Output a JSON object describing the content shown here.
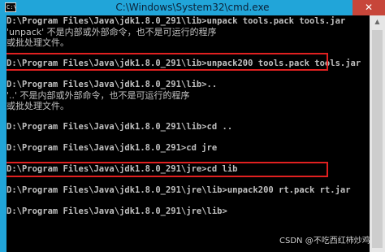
{
  "window": {
    "title": "C:\\Windows\\System32\\cmd.exe",
    "icon_label": "C:\\",
    "close_symbol": "✕"
  },
  "console": {
    "lines": [
      "D:\\Program Files\\Java\\jdk1.8.0_291\\lib>unpack tools.pack tools.jar",
      "'unpack' 不是内部或外部命令，也不是可运行的程序",
      "或批处理文件。",
      "",
      "D:\\Program Files\\Java\\jdk1.8.0_291\\lib>unpack200 tools.pack tools.jar",
      "",
      "D:\\Program Files\\Java\\jdk1.8.0_291\\lib>..",
      "'..' 不是内部或外部命令，也不是可运行的程序",
      "或批处理文件。",
      "",
      "D:\\Program Files\\Java\\jdk1.8.0_291\\lib>cd ..",
      "",
      "D:\\Program Files\\Java\\jdk1.8.0_291>cd jre",
      "",
      "D:\\Program Files\\Java\\jdk1.8.0_291\\jre>cd lib",
      "",
      "D:\\Program Files\\Java\\jdk1.8.0_291\\jre\\lib>unpack200 rt.pack rt.jar",
      "",
      "D:\\Program Files\\Java\\jdk1.8.0_291\\jre\\lib>"
    ]
  },
  "scrollbar": {
    "up_arrow": "▲"
  },
  "watermark": "CSDN @不吃西红柿炒鸡蛋",
  "colors": {
    "titlebar": "#21a5d9",
    "close": "#c7463a",
    "highlight": "#e02020",
    "text": "#c0c0c0"
  }
}
